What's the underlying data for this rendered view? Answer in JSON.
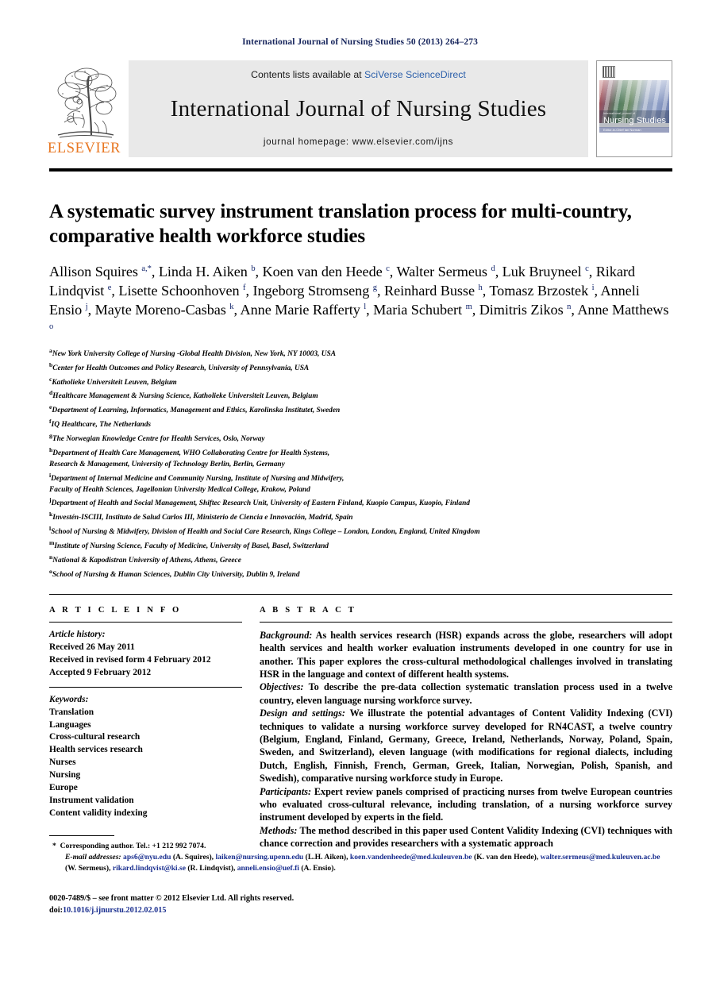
{
  "running_head": "International Journal of Nursing Studies 50 (2013) 264–273",
  "masthead": {
    "contents_prefix": "Contents lists available at ",
    "contents_link": "SciVerse ScienceDirect",
    "journal_title": "International Journal of Nursing Studies",
    "homepage": "journal homepage: www.elsevier.com/ijns",
    "publisher": "ELSEVIER",
    "cover": {
      "small_text": "international journal of",
      "big_text": "Nursing Studies",
      "bar_text": "Editor-in-Chief  Ian Norman"
    }
  },
  "article": {
    "title": "A systematic survey instrument translation process for multi-country, comparative health workforce studies",
    "authors_html": "Allison Squires <sup>a,*</sup>, Linda H. Aiken <sup>b</sup>, Koen van den Heede <sup>c</sup>, Walter Sermeus <sup>d</sup>, Luk Bruyneel <sup>c</sup>, Rikard Lindqvist <sup>e</sup>, Lisette Schoonhoven <sup>f</sup>, Ingeborg Stromseng <sup>g</sup>, Reinhard Busse <sup>h</sup>, Tomasz Brzostek <sup>i</sup>, Anneli Ensio <sup>j</sup>, Mayte Moreno-Casbas <sup>k</sup>, Anne Marie Rafferty <sup>l</sup>, Maria Schubert <sup>m</sup>, Dimitris Zikos <sup>n</sup>, Anne Matthews <sup>o</sup>",
    "affiliations": [
      {
        "mark": "a",
        "text": "New York University College of Nursing -Global Health Division, New York, NY 10003, USA"
      },
      {
        "mark": "b",
        "text": "Center for Health Outcomes and Policy Research, University of Pennsylvania, USA"
      },
      {
        "mark": "c",
        "text": "Katholieke Universiteit Leuven, Belgium"
      },
      {
        "mark": "d",
        "text": "Healthcare Management & Nursing Science, Katholieke Universiteit Leuven, Belgium"
      },
      {
        "mark": "e",
        "text": "Department of Learning, Informatics, Management and Ethics, Karolinska Institutet, Sweden"
      },
      {
        "mark": "f",
        "text": "IQ Healthcare, The Netherlands"
      },
      {
        "mark": "g",
        "text": "The Norwegian Knowledge Centre for Health Services, Oslo, Norway"
      },
      {
        "mark": "h",
        "text": "Department of Health Care Management, WHO Collaborating Centre for Health Systems,"
      },
      {
        "mark": "",
        "text": "Research & Management, University of Technology Berlin, Berlin, Germany"
      },
      {
        "mark": "i",
        "text": "Department of Internal Medicine and Community Nursing, Institute of Nursing and Midwifery,"
      },
      {
        "mark": "",
        "text": "Faculty of Health Sciences, Jagellonian University Medical College, Krakow, Poland"
      },
      {
        "mark": "j",
        "text": "Department of Health and Social Management, Shiftec Research Unit, University of Eastern Finland, Kuopio Campus, Kuopio, Finland"
      },
      {
        "mark": "k",
        "text": "Investén-ISCIII, Instituto de Salud Carlos III, Ministerio de Ciencia e Innovación, Madrid, Spain"
      },
      {
        "mark": "l",
        "text": "School of Nursing & Midwifery, Division of Health and Social Care Research, Kings College – London, London, England, United Kingdom"
      },
      {
        "mark": "m",
        "text": "Institute of Nursing Science, Faculty of Medicine, University of Basel, Basel, Switzerland"
      },
      {
        "mark": "n",
        "text": "National & Kapodistran University of Athens, Athens, Greece"
      },
      {
        "mark": "o",
        "text": "School of Nursing & Human Sciences, Dublin City University, Dublin 9, Ireland"
      }
    ]
  },
  "article_info": {
    "heading": "A R T I C L E    I N F O",
    "history_label": "Article history:",
    "history": [
      "Received 26 May 2011",
      "Received in revised form 4 February 2012",
      "Accepted 9 February 2012"
    ],
    "keywords_label": "Keywords:",
    "keywords": [
      "Translation",
      "Languages",
      "Cross-cultural research",
      "Health services research",
      "Nurses",
      "Nursing",
      "Europe",
      "Instrument validation",
      "Content validity indexing"
    ]
  },
  "abstract": {
    "heading": "A B S T R A C T",
    "sections": [
      {
        "label": "Background:",
        "text": " As health services research (HSR) expands across the globe, researchers will adopt health services and health worker evaluation instruments developed in one country for use in another. This paper explores the cross-cultural methodological challenges involved in translating HSR in the language and context of different health systems."
      },
      {
        "label": "Objectives:",
        "text": " To describe the pre-data collection systematic translation process used in a twelve country, eleven language nursing workforce survey."
      },
      {
        "label": "Design and settings:",
        "text": " We illustrate the potential advantages of Content Validity Indexing (CVI) techniques to validate a nursing workforce survey developed for RN4CAST, a twelve country (Belgium, England, Finland, Germany, Greece, Ireland, Netherlands, Norway, Poland, Spain, Sweden, and Switzerland), eleven language (with modifications for regional dialects, including Dutch, English, Finnish, French, German, Greek, Italian, Norwegian, Polish, Spanish, and Swedish), comparative nursing workforce study in Europe."
      },
      {
        "label": "Participants:",
        "text": " Expert review panels comprised of practicing nurses from twelve European countries who evaluated cross-cultural relevance, including translation, of a nursing workforce survey instrument developed by experts in the field."
      },
      {
        "label": "Methods:",
        "text": " The method described in this paper used Content Validity Indexing (CVI) techniques with chance correction and provides researchers with a systematic approach"
      }
    ]
  },
  "footnotes": {
    "corresponding": "Corresponding author. Tel.: +1 212 992 7074.",
    "email_label": "E-mail addresses:",
    "emails": [
      {
        "mail": "aps6@nyu.edu",
        "who": " (A. Squires), "
      },
      {
        "mail": "laiken@nursing.upenn.edu",
        "who": " (L.H. Aiken), "
      },
      {
        "mail": "koen.vandenheede@med.kuleuven.be",
        "who": " (K. van den Heede), "
      },
      {
        "mail": "walter.sermeus@med.kuleuven.ac.be",
        "who": " (W. Sermeus), "
      },
      {
        "mail": "rikard.lindqvist@ki.se",
        "who": " (R. Lindqvist), "
      },
      {
        "mail": "anneli.ensio@uef.fi",
        "who": " (A. Ensio)."
      }
    ]
  },
  "imprint": {
    "line1": "0020-7489/$ – see front matter © 2012 Elsevier Ltd. All rights reserved.",
    "doi_prefix": "doi:",
    "doi": "10.1016/j.ijnurstu.2012.02.015"
  }
}
